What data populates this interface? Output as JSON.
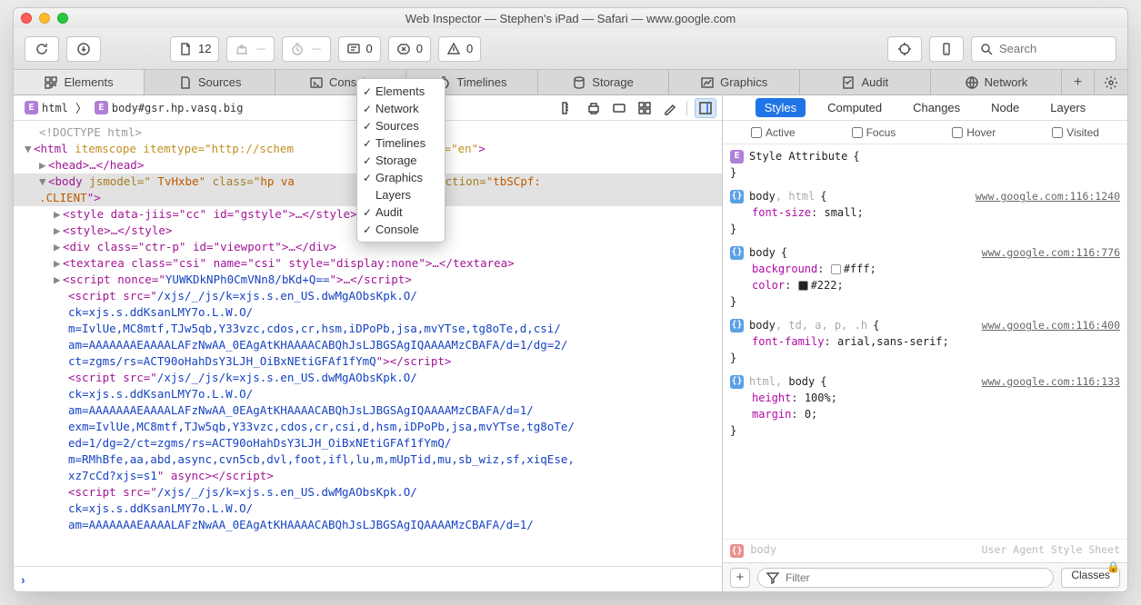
{
  "window": {
    "title": "Web Inspector — Stephen's iPad — Safari — www.google.com"
  },
  "toolbar": {
    "doc_count": "12",
    "download_count": "",
    "timing_count": "",
    "log_count": "0",
    "error_count": "0",
    "warn_count": "0",
    "search_placeholder": "Search"
  },
  "tabs": [
    {
      "label": "Elements",
      "active": true
    },
    {
      "label": "Sources"
    },
    {
      "label": "Console"
    },
    {
      "label": "Timelines"
    },
    {
      "label": "Storage"
    },
    {
      "label": "Graphics"
    },
    {
      "label": "Audit"
    },
    {
      "label": "Network"
    }
  ],
  "dropdown": {
    "items": [
      {
        "label": "Elements",
        "checked": true
      },
      {
        "label": "Network",
        "checked": true
      },
      {
        "label": "Sources",
        "checked": true
      },
      {
        "label": "Timelines",
        "checked": true
      },
      {
        "label": "Storage",
        "checked": true
      },
      {
        "label": "Graphics",
        "checked": true
      },
      {
        "label": "Layers",
        "checked": false
      },
      {
        "label": "Audit",
        "checked": true
      },
      {
        "label": "Console",
        "checked": true
      }
    ]
  },
  "breadcrumb": {
    "first": "html",
    "second": "body#gsr.hp.vasq.big"
  },
  "dom": {
    "l0": "<!DOCTYPE html>",
    "l1_open": "<html",
    "l1_attrs": " itemscope itemtype=\"http://schem              ge\" lang=\"en\"",
    "l1_close": ">",
    "l2": "<head>…</head>",
    "l3a": "<body",
    "l3b": " jsmodel=\"",
    "l3c": " TvHxbe",
    "l3d": "\" class=\"",
    "l3e": "hp va              gsr",
    "l3f": "\" jsaction=\"",
    "l3g": "tbSCpf:\n.CLIENT",
    "l3h": "\">",
    "l4": "<style data-jiis=\"cc\" id=\"gstyle\">…</style>",
    "l5": "<style>…</style>",
    "l6": "<div class=\"ctr-p\" id=\"viewport\">…</div>",
    "l7": "<textarea class=\"csi\" name=\"csi\" style=\"display:none\">…</textarea>",
    "l8a": "<script nonce=\"",
    "l8b": "YUWKDkNPh0CmVNn8/bKd+Q==",
    "l8c": "\">…</script>",
    "l9a": "<script src=\"",
    "l9b": "/xjs/_/js/k=xjs.s.en_US.dwMgAObsKpk.O/\nck=xjs.s.ddKsanLMY7o.L.W.O/\nm=IvlUe,MC8mtf,TJw5qb,Y33vzc,cdos,cr,hsm,iDPoPb,jsa,mvYTse,tg8oTe,d,csi/\nam=AAAAAAAEAAAALAFzNwAA_0EAgAtKHAAAACABQhJsLJBGSAgIQAAAAMzCBAFA/d=1/dg=2/\nct=zgms/rs=ACT90oHahDsY3LJH_OiBxNEtiGFAf1fYmQ",
    "l9c": "\"></script>",
    "l10a": "<script src=\"",
    "l10b": "/xjs/_/js/k=xjs.s.en_US.dwMgAObsKpk.O/\nck=xjs.s.ddKsanLMY7o.L.W.O/\nam=AAAAAAAEAAAALAFzNwAA_0EAgAtKHAAAACABQhJsLJBGSAgIQAAAAMzCBAFA/d=1/\nexm=IvlUe,MC8mtf,TJw5qb,Y33vzc,cdos,cr,csi,d,hsm,iDPoPb,jsa,mvYTse,tg8oTe/\ned=1/dg=2/ct=zgms/rs=ACT90oHahDsY3LJH_OiBxNEtiGFAf1fYmQ/\nm=RMhBfe,aa,abd,async,cvn5cb,dvl,foot,ifl,lu,m,mUpTid,mu,sb_wiz,sf,xiqEse,\nxz7cCd?xjs=s1",
    "l10c": "\" async></script>",
    "l11a": "<script src=\"",
    "l11b": "/xjs/_/js/k=xjs.s.en_US.dwMgAObsKpk.O/\nck=xjs.s.ddKsanLMY7o.L.W.O/\nam=AAAAAAAEAAAALAFzNwAA_0EAgAtKHAAAACABQhJsLJBGSAgIQAAAAMzCBAFA/d=1/"
  },
  "right": {
    "tabs": [
      "Styles",
      "Computed",
      "Changes",
      "Node",
      "Layers"
    ],
    "pseudos": [
      "Active",
      "Focus",
      "Hover",
      "Visited"
    ],
    "rules": [
      {
        "badge": "E",
        "selector": "Style Attribute",
        "src": "",
        "props": []
      },
      {
        "badge": "C",
        "selector": "body, html",
        "dim": ", html",
        "src": "www.google.com:116:1240",
        "props": [
          {
            "name": "font-size",
            "val": "small"
          }
        ]
      },
      {
        "badge": "C",
        "selector": "body",
        "src": "www.google.com:116:776",
        "props": [
          {
            "name": "background",
            "val": "#fff",
            "swatch": "white"
          },
          {
            "name": "color",
            "val": "#222",
            "swatch": "dark"
          }
        ]
      },
      {
        "badge": "C",
        "selector": "body, td, a, p, .h",
        "dim": ", td, a, p, .h",
        "src": "www.google.com:116:400",
        "props": [
          {
            "name": "font-family",
            "val": "arial,sans-serif"
          }
        ]
      },
      {
        "badge": "C",
        "selector": "html, body",
        "dim": "html, ",
        "src": "www.google.com:116:133",
        "props": [
          {
            "name": "height",
            "val": "100%"
          },
          {
            "name": "margin",
            "val": "0"
          }
        ]
      }
    ],
    "cutoff_selector": "body",
    "cutoff_src": "User Agent Style Sheet",
    "filter_placeholder": "Filter",
    "classes_label": "Classes",
    "brace_open": "  {",
    "brace_close": "}"
  }
}
